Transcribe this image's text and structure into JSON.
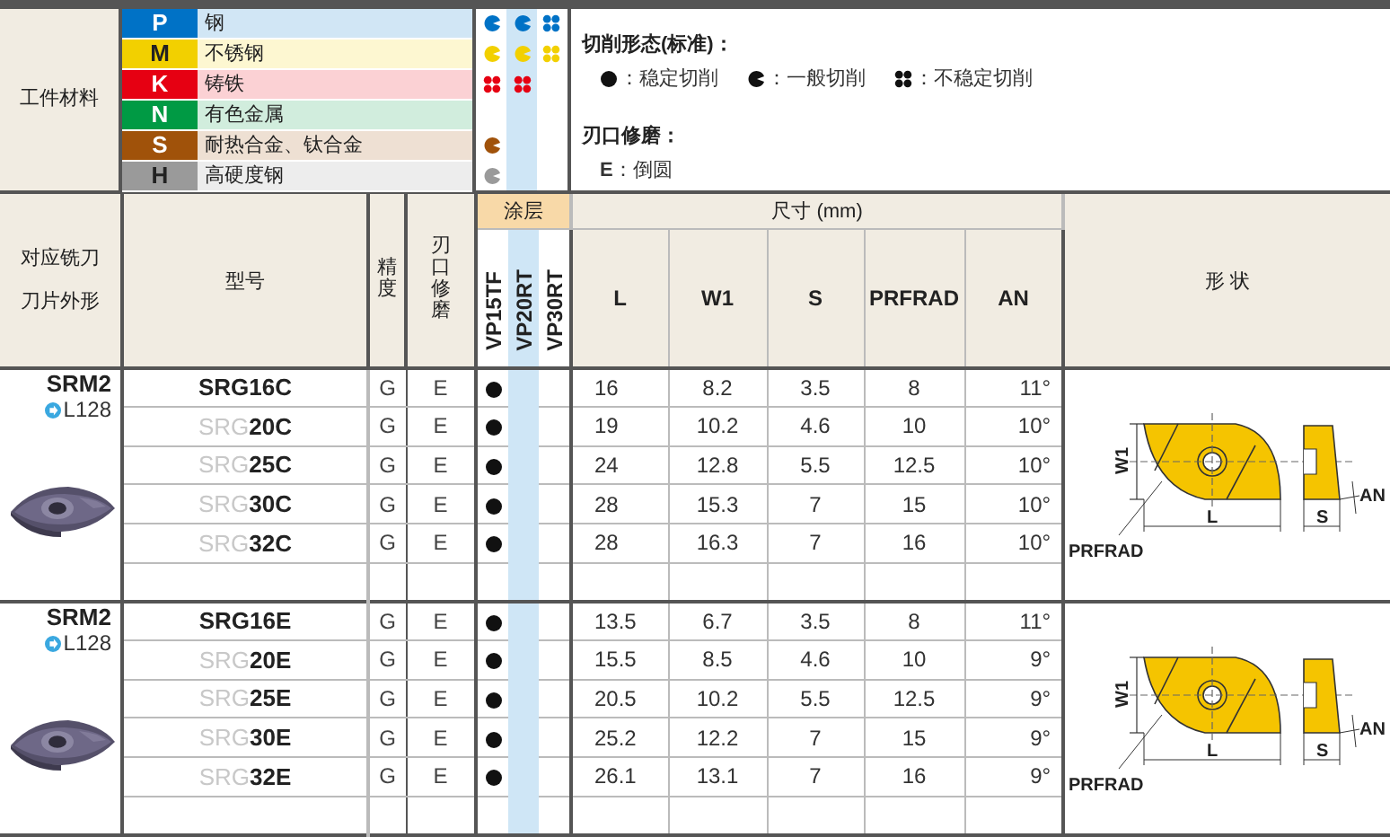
{
  "materials": {
    "label": "工件材料",
    "items": [
      {
        "code": "P",
        "name": "钢",
        "color": "#0072c6",
        "ratings": [
          {
            "kind": "general"
          },
          {
            "kind": "general"
          },
          {
            "kind": "unstable"
          }
        ]
      },
      {
        "code": "M",
        "name": "不锈钢",
        "color": "#f2d000",
        "ratings": [
          {
            "kind": "general"
          },
          {
            "kind": "general"
          },
          {
            "kind": "unstable"
          }
        ]
      },
      {
        "code": "K",
        "name": "铸铁",
        "color": "#e60012",
        "ratings": [
          {
            "kind": "unstable"
          },
          {
            "kind": "unstable"
          },
          {
            "kind": "none"
          }
        ]
      },
      {
        "code": "N",
        "name": "有色金属",
        "color": "#009a44",
        "ratings": [
          {
            "kind": "none"
          },
          {
            "kind": "none"
          },
          {
            "kind": "none"
          }
        ]
      },
      {
        "code": "S",
        "name": "耐热合金、钛合金",
        "color": "#a0520a",
        "ratings": [
          {
            "kind": "general"
          },
          {
            "kind": "none"
          },
          {
            "kind": "none"
          }
        ]
      },
      {
        "code": "H",
        "name": "高硬度钢",
        "color": "#9a9a9a",
        "ratings": [
          {
            "kind": "general"
          },
          {
            "kind": "none"
          },
          {
            "kind": "none"
          }
        ]
      }
    ]
  },
  "legend": {
    "title": "切削形态(标准)：",
    "items": [
      {
        "kind": "stable",
        "label": "：稳定切削"
      },
      {
        "kind": "general",
        "label": "：一般切削"
      },
      {
        "kind": "unstable",
        "label": "：不稳定切削"
      }
    ],
    "honing_title": "刃口修磨：",
    "honing_item": "**E**：倒圆"
  },
  "header": {
    "shape_col": [
      "对应铣刀",
      "刀片外形"
    ],
    "model": "型号",
    "precision": "精度",
    "honing": "刃口修磨",
    "coating": "涂层",
    "grades": [
      "VP15TF",
      "VP20RT",
      "VP30RT"
    ],
    "dimensions": "尺寸 (mm)",
    "dims": [
      "L",
      "W1",
      "S",
      "PRFRAD",
      "AN"
    ],
    "form": "形 状"
  },
  "groups": [
    {
      "series": "SRM2",
      "ref": "L128",
      "labels": {
        "w1": "W1",
        "l": "L",
        "prfrad": "PRFRAD",
        "s": "S",
        "an": "AN"
      },
      "rows": [
        {
          "prefix": "SRG",
          "suffix": "16C",
          "prefix_faded": false,
          "precision": "G",
          "honing": "E",
          "coatings": [
            {
              "stocked": true
            },
            {
              "stocked": false
            },
            {
              "stocked": false
            }
          ],
          "dims": [
            "16",
            "8.2",
            "3.5",
            "8",
            "11°"
          ]
        },
        {
          "prefix": "SRG",
          "suffix": "20C",
          "prefix_faded": true,
          "precision": "G",
          "honing": "E",
          "coatings": [
            {
              "stocked": true
            },
            {
              "stocked": false
            },
            {
              "stocked": false
            }
          ],
          "dims": [
            "19",
            "10.2",
            "4.6",
            "10",
            "10°"
          ]
        },
        {
          "prefix": "SRG",
          "suffix": "25C",
          "prefix_faded": true,
          "precision": "G",
          "honing": "E",
          "coatings": [
            {
              "stocked": true
            },
            {
              "stocked": false
            },
            {
              "stocked": false
            }
          ],
          "dims": [
            "24",
            "12.8",
            "5.5",
            "12.5",
            "10°"
          ]
        },
        {
          "prefix": "SRG",
          "suffix": "30C",
          "prefix_faded": true,
          "precision": "G",
          "honing": "E",
          "coatings": [
            {
              "stocked": true
            },
            {
              "stocked": false
            },
            {
              "stocked": false
            }
          ],
          "dims": [
            "28",
            "15.3",
            "7",
            "15",
            "10°"
          ]
        },
        {
          "prefix": "SRG",
          "suffix": "32C",
          "prefix_faded": true,
          "precision": "G",
          "honing": "E",
          "coatings": [
            {
              "stocked": true
            },
            {
              "stocked": false
            },
            {
              "stocked": false
            }
          ],
          "dims": [
            "28",
            "16.3",
            "7",
            "16",
            "10°"
          ]
        }
      ]
    },
    {
      "series": "SRM2",
      "ref": "L128",
      "labels": {
        "w1": "W1",
        "l": "L",
        "prfrad": "PRFRAD",
        "s": "S",
        "an": "AN"
      },
      "rows": [
        {
          "prefix": "SRG",
          "suffix": "16E",
          "prefix_faded": false,
          "precision": "G",
          "honing": "E",
          "coatings": [
            {
              "stocked": true
            },
            {
              "stocked": false
            },
            {
              "stocked": false
            }
          ],
          "dims": [
            "13.5",
            "6.7",
            "3.5",
            "8",
            "11°"
          ]
        },
        {
          "prefix": "SRG",
          "suffix": "20E",
          "prefix_faded": true,
          "precision": "G",
          "honing": "E",
          "coatings": [
            {
              "stocked": true
            },
            {
              "stocked": false
            },
            {
              "stocked": false
            }
          ],
          "dims": [
            "15.5",
            "8.5",
            "4.6",
            "10",
            "9°"
          ]
        },
        {
          "prefix": "SRG",
          "suffix": "25E",
          "prefix_faded": true,
          "precision": "G",
          "honing": "E",
          "coatings": [
            {
              "stocked": true
            },
            {
              "stocked": false
            },
            {
              "stocked": false
            }
          ],
          "dims": [
            "20.5",
            "10.2",
            "5.5",
            "12.5",
            "9°"
          ]
        },
        {
          "prefix": "SRG",
          "suffix": "30E",
          "prefix_faded": true,
          "precision": "G",
          "honing": "E",
          "coatings": [
            {
              "stocked": true
            },
            {
              "stocked": false
            },
            {
              "stocked": false
            }
          ],
          "dims": [
            "25.2",
            "12.2",
            "7",
            "15",
            "9°"
          ]
        },
        {
          "prefix": "SRG",
          "suffix": "32E",
          "prefix_faded": true,
          "precision": "G",
          "honing": "E",
          "coatings": [
            {
              "stocked": true
            },
            {
              "stocked": false
            },
            {
              "stocked": false
            }
          ],
          "dims": [
            "26.1",
            "13.1",
            "7",
            "16",
            "9°"
          ]
        }
      ]
    }
  ]
}
